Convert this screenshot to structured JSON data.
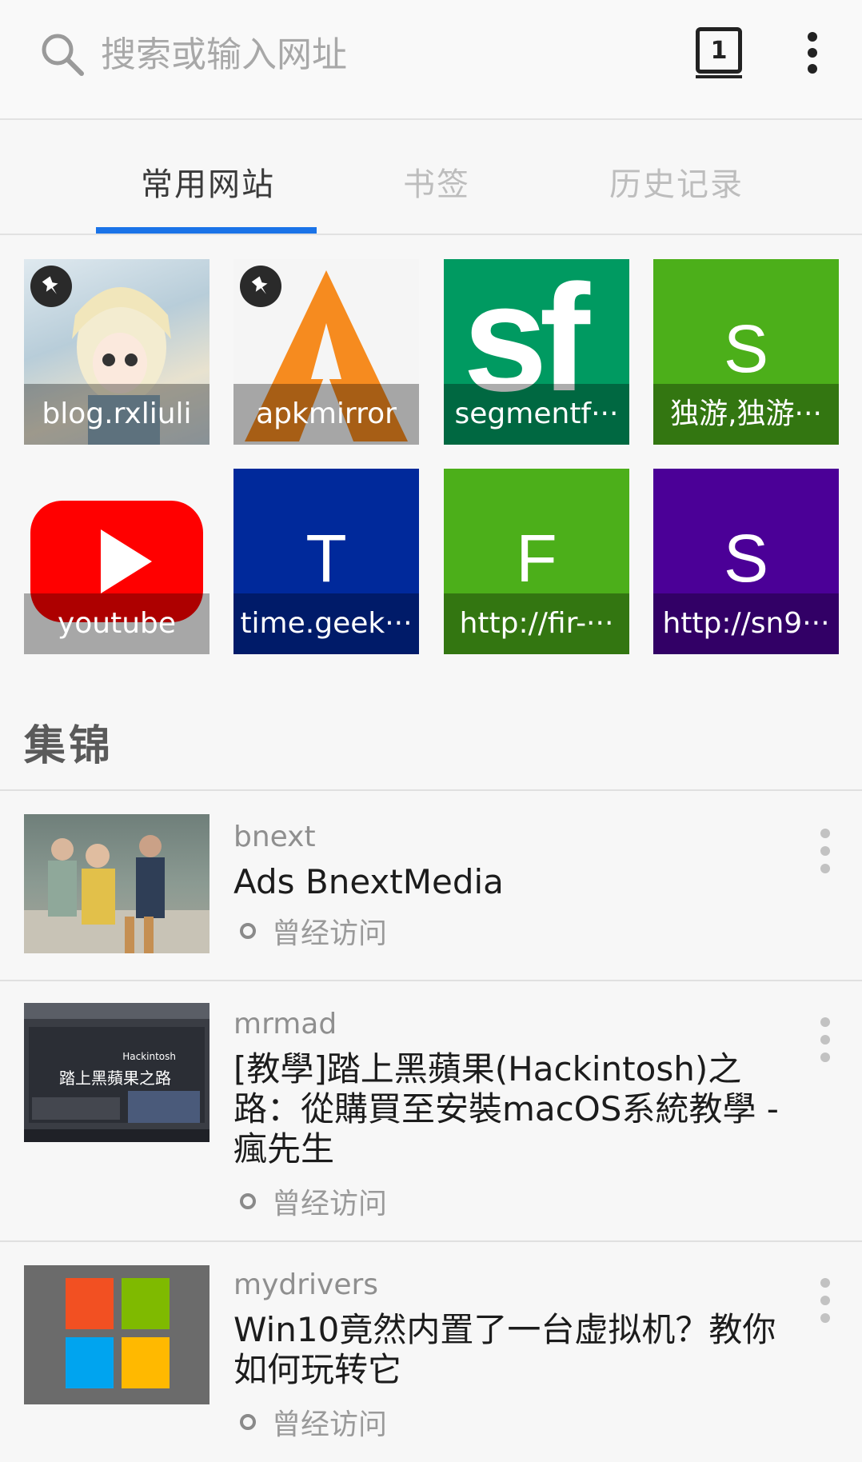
{
  "urlbar": {
    "placeholder": "搜索或输入网址",
    "tab_count": "1"
  },
  "tabs": [
    {
      "label": "常用网站",
      "active": true
    },
    {
      "label": "书签",
      "active": false
    },
    {
      "label": "历史记录",
      "active": false
    }
  ],
  "top_sites": [
    {
      "label": "blog.rxliuli",
      "pinned": true,
      "color": "#c9d9e4"
    },
    {
      "label": "apkmirror",
      "pinned": true,
      "color": "#f0f0f0"
    },
    {
      "label": "segmentf···",
      "pinned": false,
      "color": "#009a61",
      "letter": "sf"
    },
    {
      "label": "独游,独游···",
      "pinned": false,
      "color": "#4caf1a",
      "letter": "S"
    },
    {
      "label": "youtube",
      "pinned": false,
      "color": "#f7f7f7"
    },
    {
      "label": "time.geek···",
      "pinned": false,
      "color": "#00299b",
      "letter": "T"
    },
    {
      "label": "http://fir-···",
      "pinned": false,
      "color": "#4caf1a",
      "letter": "F"
    },
    {
      "label": "http://sn9···",
      "pinned": false,
      "color": "#4b0097",
      "letter": "S"
    }
  ],
  "collections": {
    "title": "集锦",
    "items": [
      {
        "source": "bnext",
        "title": "Ads BnextMedia",
        "visited": "曾经访问"
      },
      {
        "source": "mrmad",
        "title": "[教學]踏上黑蘋果(Hackintosh)之路：從購買至安裝macOS系統教學 - 瘋先生",
        "visited": "曾经访问"
      },
      {
        "source": "mydrivers",
        "title": "Win10竟然内置了一台虚拟机？教你如何玩转它",
        "visited": "曾经访问"
      }
    ]
  },
  "thumb_text": {
    "mrmad_line1": "Hackintosh",
    "mrmad_line2": "踏上黑蘋果之路"
  },
  "colors": {
    "accent": "#1a73e8"
  }
}
